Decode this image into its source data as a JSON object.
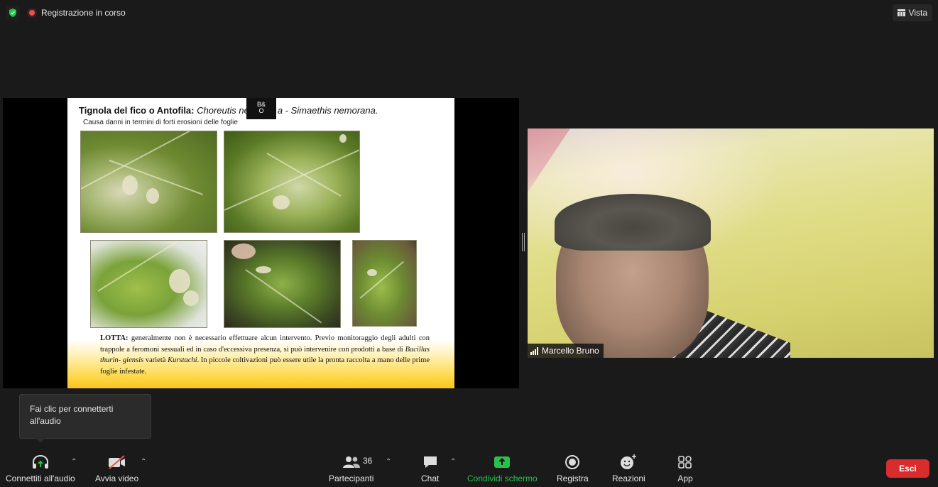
{
  "topbar": {
    "security_icon": "shield-check-icon",
    "recording_label": "Registrazione in corso",
    "view_label": "Vista"
  },
  "slide": {
    "title_bold": "Tignola del fico o Antofila:",
    "title_italic": "Choreutis ne",
    "title_italic_tail": "a - Simaethis nemorana.",
    "subtitle": "Causa danni in termini di forti erosioni delle foglie",
    "watermark": "B&O",
    "body_label": "LOTTA:",
    "body_text_1": "generalmente non è necessario effettuare alcun intervento. Previo monitoraggio degli adulti con trappole a feromoni sessuali ed in caso d'eccessiva presenza, si può intervenire con prodotti a base di",
    "body_italic_1": "Bacillus thurin- giensis",
    "body_text_2": "varietà",
    "body_italic_2": "Kurstachi",
    "body_text_3": ". In piccole coltivazioni può essere utile la pronta raccolta a mano delle prime foglie infestate."
  },
  "participant": {
    "name": "Marcello Bruno",
    "signal_icon": "signal-bars-icon"
  },
  "tooltip": {
    "text": "Fai clic per connetterti all'audio"
  },
  "toolbar": {
    "audio_label": "Connettiti all'audio",
    "video_label": "Avvia video",
    "participants_label": "Partecipanti",
    "participants_count": "36",
    "chat_label": "Chat",
    "share_label": "Condividi schermo",
    "record_label": "Registra",
    "reactions_label": "Reazioni",
    "apps_label": "App",
    "leave_label": "Esci"
  },
  "colors": {
    "background": "#1a1a1a",
    "share_accent": "#27c24c",
    "leave_red": "#d92c2c",
    "recording_red": "#e8534b"
  }
}
